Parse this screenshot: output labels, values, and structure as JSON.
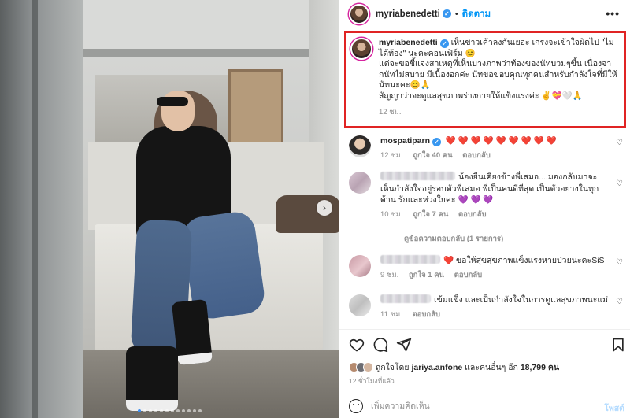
{
  "post": {
    "username": "myriabenedetti",
    "follow_label": "ติดตาม",
    "more_label": "•••",
    "next_icon": "›",
    "slide_count": 12,
    "active_slide": 1
  },
  "caption": {
    "username": "myriabenedetti",
    "text_line1": "เห็นข่าวเค้าลงกันเยอะ เกรงจะเข้าใจผิดไป \"ไม่ได้ท้อง\" นะคะคอนเฟิร์ม 😊",
    "text_line2": "แต่จะขอชี้แจงสาเหตุที่เห็นบางภาพว่าท้องของนัทบวมๆขึ้น เนื่องจากนัทไม่สบาย มีเนื้องอกค่ะ นัทขอขอบคุณทุกคนสำหรับกำลังใจที่มีให้นัทนะคะ😊🙏",
    "text_line3": "สัญญาว่าจะดูแลสุขภาพร่างกายให้แข็งแรงค่ะ ✌️💝🤍🙏",
    "time": "12 ชม."
  },
  "comments": [
    {
      "username": "mospatiparn",
      "text": "❤️ ❤️ ❤️ ❤️ ❤️ ❤️ ❤️ ❤️ ❤️",
      "time": "12 ชม.",
      "likes": "ถูกใจ 40 คน",
      "reply": "ตอบกลับ"
    },
    {
      "username_hidden": true,
      "text": "น้องยืนเคียงข้างพี่เสมอ....มองกลับมาจะเห็นกำลังใจอยู่รอบตัวพี่เสมอ พี่เป็นคนดีที่สุด เป็นตัวอย่างในทุกด้าน รักและห่วงใยค่ะ 💜 💜 💜",
      "time": "10 ชม.",
      "likes": "ถูกใจ 7 คน",
      "reply": "ตอบกลับ",
      "view_replies": "ดูข้อความตอบกลับ (1 รายการ)"
    },
    {
      "username_hidden": true,
      "text": "❤️ ขอให้สุขสุขภาพแข็งแรงหายป่วยนะคะSiS",
      "time": "9 ชม.",
      "likes": "ถูกใจ 1 คน",
      "reply": "ตอบกลับ"
    },
    {
      "username_hidden": true,
      "text": "เข้มแข็ง และเป็นกำลังใจในการดูแลสุขภาพนะแม่",
      "time": "11 ชม.",
      "reply": "ตอบกลับ"
    }
  ],
  "likes_summary": {
    "prefix": "ถูกใจโดย",
    "liker": "jariya.anfone",
    "middle": "และคนอื่นๆ อีก",
    "count": "18,799 คน"
  },
  "posted_ago": "12 ชั่วโมงที่แล้ว",
  "add_comment": {
    "placeholder": "เพิ่มความคิดเห็น",
    "post_label": "โพสต์"
  },
  "colors": {
    "link_blue": "#0095f6",
    "highlight_border": "#e02424",
    "like_red": "#ed4956"
  }
}
